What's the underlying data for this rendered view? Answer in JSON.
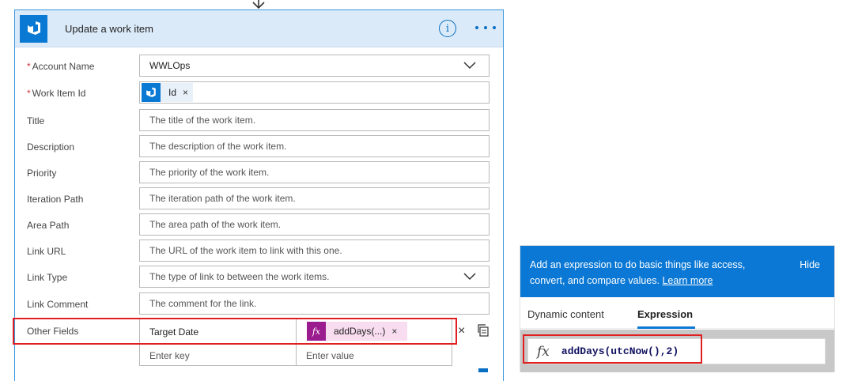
{
  "card": {
    "title": "Update a work item",
    "info_symbol": "i"
  },
  "fields": {
    "account_name": {
      "label": "Account Name",
      "required": "*",
      "value": "WWLOps"
    },
    "work_item_id": {
      "label": "Work Item Id",
      "required": "*",
      "token_label": "Id",
      "token_remove": "×"
    },
    "title": {
      "label": "Title",
      "placeholder": "The title of the work item."
    },
    "description": {
      "label": "Description",
      "placeholder": "The description of the work item."
    },
    "priority": {
      "label": "Priority",
      "placeholder": "The priority of the work item."
    },
    "iteration_path": {
      "label": "Iteration Path",
      "placeholder": "The iteration path of the work item."
    },
    "area_path": {
      "label": "Area Path",
      "placeholder": "The area path of the work item."
    },
    "link_url": {
      "label": "Link URL",
      "placeholder": "The URL of the work item to link with this one."
    },
    "link_type": {
      "label": "Link Type",
      "placeholder": "The type of link to between the work items."
    },
    "link_comment": {
      "label": "Link Comment",
      "placeholder": "The comment for the link."
    }
  },
  "other_fields": {
    "label": "Other Fields",
    "key": "Target Date",
    "expression_token": "addDays(...)",
    "token_remove": "×",
    "fx_symbol": "fx",
    "key_placeholder": "Enter key",
    "value_placeholder": "Enter value",
    "delete_symbol": "×"
  },
  "expression_panel": {
    "banner_text": "Add an expression to do basic things like access, convert, and compare values.",
    "learn_more": "Learn more",
    "hide": "Hide",
    "tabs": [
      "Dynamic content",
      "Expression"
    ],
    "active_tab": "Expression",
    "fx_symbol": "fx",
    "expression": "addDays(utcNow(),2)"
  },
  "colors": {
    "accent": "#0a78d4",
    "card_header": "#dbeaf8",
    "expression_token": "#9b1c8f",
    "highlight": "#e02020",
    "required": "#d13438"
  }
}
